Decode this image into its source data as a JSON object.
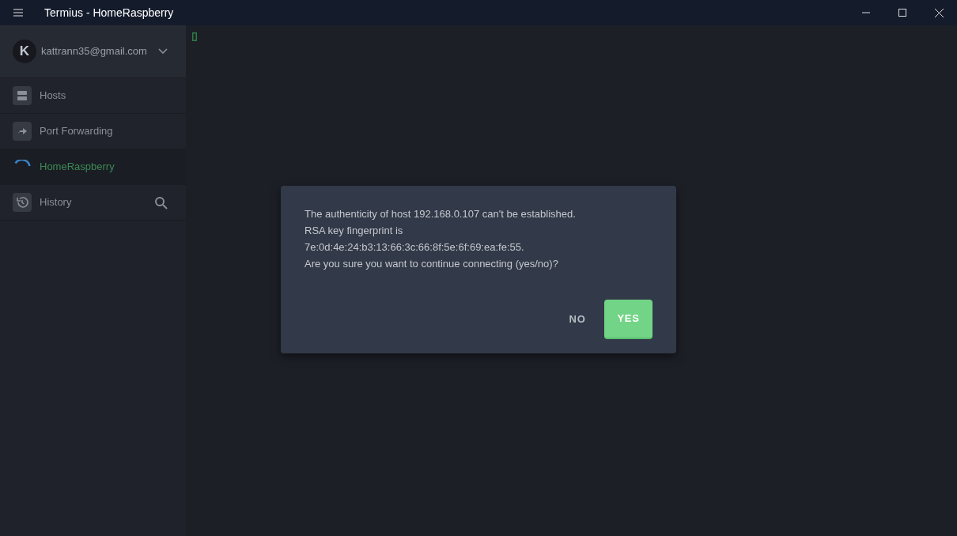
{
  "window": {
    "title": "Termius - HomeRaspberry"
  },
  "account": {
    "initial": "K",
    "email": "kattrann35@gmail.com"
  },
  "sidebar": {
    "items": [
      {
        "kind": "hosts",
        "label": "Hosts",
        "selected": false
      },
      {
        "kind": "forwarding",
        "label": "Port Forwarding",
        "selected": false
      },
      {
        "kind": "connecting",
        "label": "HomeRaspberry",
        "selected": true
      },
      {
        "kind": "history",
        "label": "History",
        "selected": false
      }
    ]
  },
  "dialog": {
    "lines": [
      "The authenticity of host 192.168.0.107 can't be established.",
      "RSA key fingerprint is",
      "7e:0d:4e:24:b3:13:66:3c:66:8f:5e:6f:69:ea:fe:55.",
      "Are you sure you want to continue connecting (yes/no)?"
    ],
    "buttons": [
      {
        "kind": "flat",
        "label": "NO"
      },
      {
        "kind": "primary",
        "label": "YES"
      }
    ]
  }
}
